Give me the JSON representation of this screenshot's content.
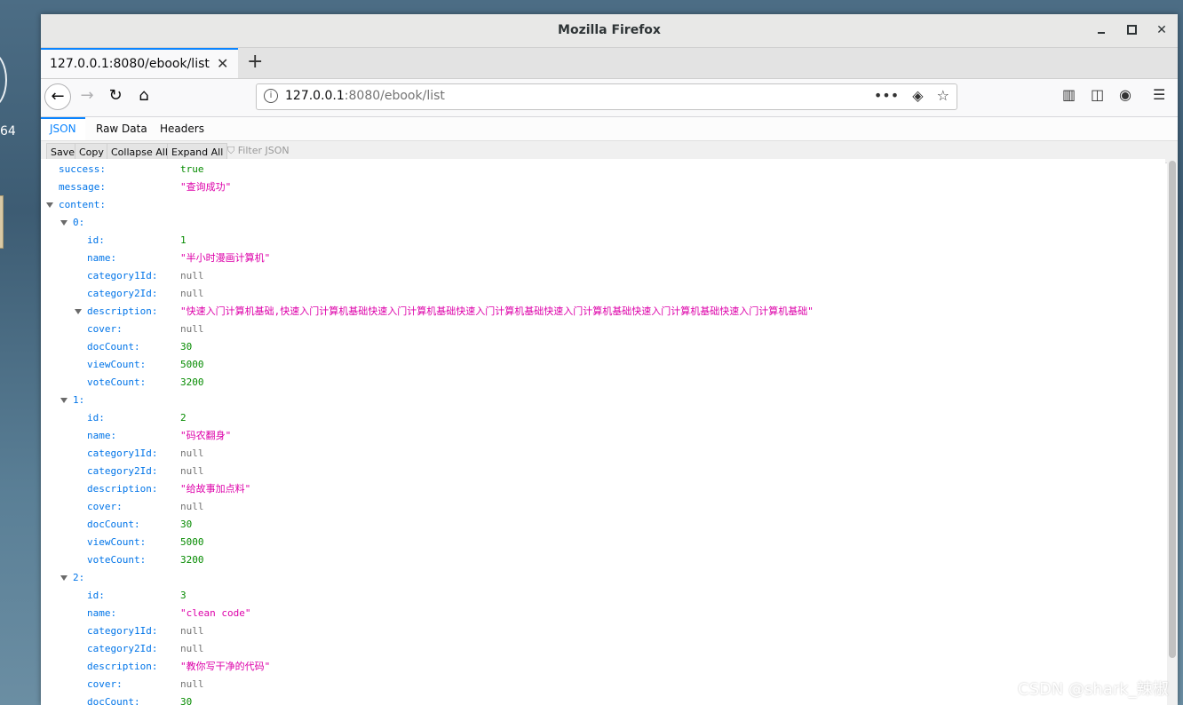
{
  "desktop": {
    "side_text": "64"
  },
  "window": {
    "title": "Mozilla Firefox"
  },
  "tab": {
    "title": "127.0.0.1:8080/ebook/list",
    "close": "✕",
    "new_tab": "+"
  },
  "url": {
    "host": "127.0.0.1",
    "rest": ":8080/ebook/list"
  },
  "viewer": {
    "tabs": [
      "JSON",
      "Raw Data",
      "Headers"
    ],
    "toolbar": [
      "Save",
      "Copy",
      "Collapse All",
      "Expand All"
    ],
    "filter_placeholder": "Filter JSON"
  },
  "json": {
    "success": "true",
    "message": "\"查询成功\"",
    "content_key": "content:",
    "items": [
      {
        "index": "0:",
        "fields": [
          [
            "id:",
            "1",
            "num"
          ],
          [
            "name:",
            "\"半小时漫画计算机\"",
            "str"
          ],
          [
            "category1Id:",
            "null",
            "null"
          ],
          [
            "category2Id:",
            "null",
            "null"
          ],
          [
            "description:",
            "\"快速入门计算机基础,快速入门计算机基础快速入门计算机基础快速入门计算机基础快速入门计算机基础快速入门计算机基础快速入门计算机基础\"",
            "str"
          ],
          [
            "cover:",
            "null",
            "null"
          ],
          [
            "docCount:",
            "30",
            "num"
          ],
          [
            "viewCount:",
            "5000",
            "num"
          ],
          [
            "voteCount:",
            "3200",
            "num"
          ]
        ]
      },
      {
        "index": "1:",
        "fields": [
          [
            "id:",
            "2",
            "num"
          ],
          [
            "name:",
            "\"码农翻身\"",
            "str"
          ],
          [
            "category1Id:",
            "null",
            "null"
          ],
          [
            "category2Id:",
            "null",
            "null"
          ],
          [
            "description:",
            "\"给故事加点料\"",
            "str"
          ],
          [
            "cover:",
            "null",
            "null"
          ],
          [
            "docCount:",
            "30",
            "num"
          ],
          [
            "viewCount:",
            "5000",
            "num"
          ],
          [
            "voteCount:",
            "3200",
            "num"
          ]
        ]
      },
      {
        "index": "2:",
        "fields": [
          [
            "id:",
            "3",
            "num"
          ],
          [
            "name:",
            "\"clean code\"",
            "str"
          ],
          [
            "category1Id:",
            "null",
            "null"
          ],
          [
            "category2Id:",
            "null",
            "null"
          ],
          [
            "description:",
            "\"教你写干净的代码\"",
            "str"
          ],
          [
            "cover:",
            "null",
            "null"
          ],
          [
            "docCount:",
            "30",
            "num"
          ]
        ]
      }
    ]
  },
  "watermark": "CSDN @shark_辣椒",
  "colors": {
    "accent": "#0a84ff",
    "key": "#0074e8",
    "string": "#dd00a9",
    "number": "#058b00",
    "null": "#737373"
  }
}
